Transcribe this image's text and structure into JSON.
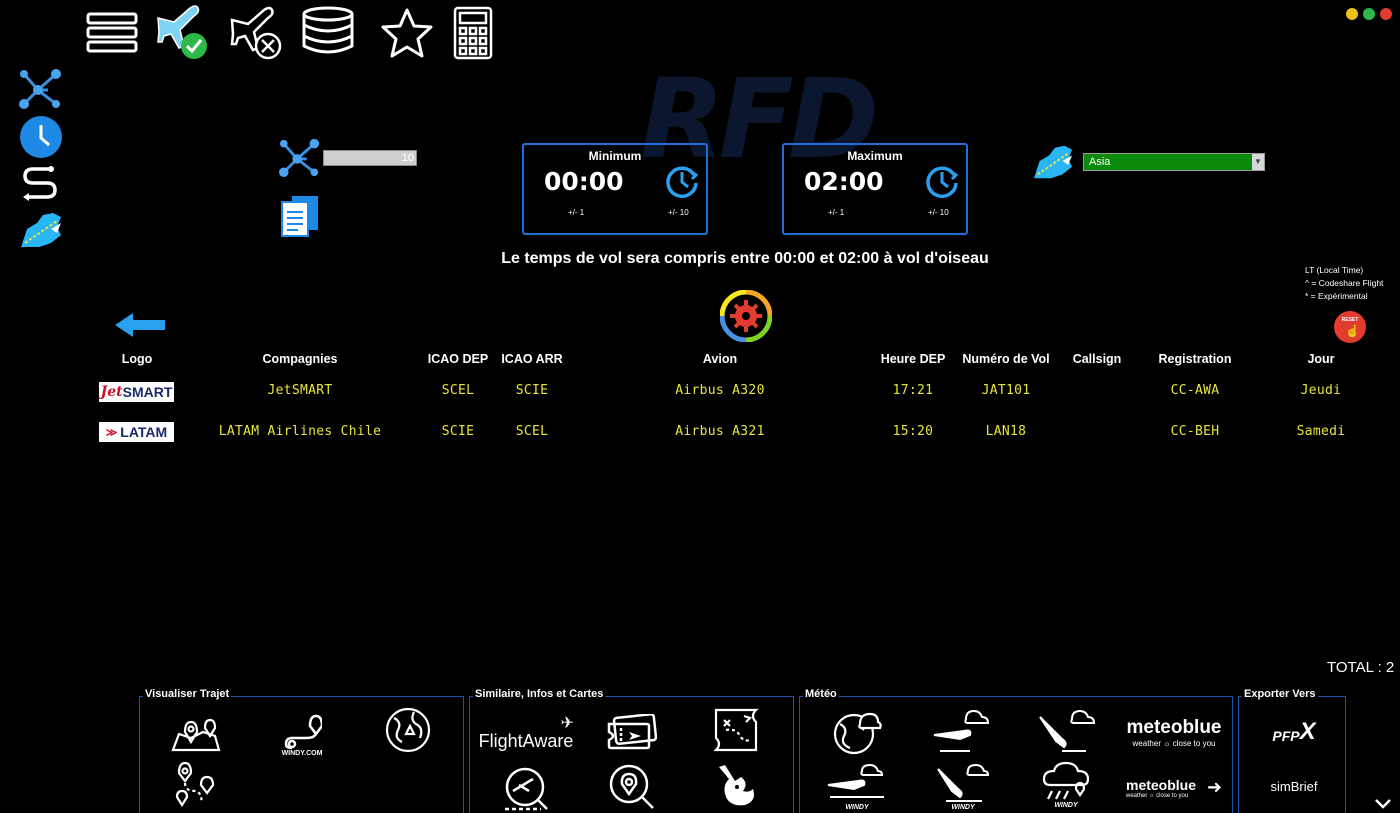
{
  "watermark": "RFD",
  "toolbar": {
    "icons": [
      "menu-icon",
      "plane-check-icon",
      "plane-cancel-icon",
      "database-icon",
      "star-icon",
      "calculator-icon"
    ]
  },
  "sidebar": {
    "icons": [
      "route-network-icon",
      "clock-icon",
      "path-icon",
      "airline-region-icon"
    ]
  },
  "range": {
    "value": "10"
  },
  "minimum": {
    "label": "Minimum",
    "time": "00:00",
    "step1": "+/- 1",
    "step10": "+/- 10"
  },
  "maximum": {
    "label": "Maximum",
    "time": "02:00",
    "step1": "+/- 1",
    "step10": "+/- 10"
  },
  "region": {
    "selected": "Asia"
  },
  "summary": "Le temps de vol sera compris entre 00:00 et 02:00 à vol d'oiseau",
  "legend": {
    "line1": "LT (Local Time)",
    "line2": "^ = Codeshare Flight",
    "line3": "* = Expérimental"
  },
  "reset_label": "RESET",
  "table": {
    "headers": {
      "logo": "Logo",
      "company": "Compagnies",
      "icao_dep": "ICAO DEP",
      "icao_arr": "ICAO ARR",
      "aircraft": "Avion",
      "dep_time": "Heure DEP",
      "flight_no": "Numéro de Vol",
      "callsign": "Callsign",
      "registration": "Registration",
      "day": "Jour"
    },
    "rows": [
      {
        "logo_a": "Jet",
        "logo_b": "SMART",
        "company": "JetSMART",
        "icao_dep": "SCEL",
        "icao_arr": "SCIE",
        "aircraft": "Airbus A320",
        "dep_time": "17:21",
        "flight_no": "JAT101",
        "callsign": "",
        "registration": "CC-AWA",
        "day": "Jeudi"
      },
      {
        "logo_a": "",
        "logo_b": "LATAM",
        "company": "LATAM Airlines Chile",
        "icao_dep": "SCIE",
        "icao_arr": "SCEL",
        "aircraft": "Airbus A321",
        "dep_time": "15:20",
        "flight_no": "LAN18",
        "callsign": "",
        "registration": "CC-BEH",
        "day": "Samedi"
      }
    ]
  },
  "total": "TOTAL : 2",
  "groups": {
    "trajet": {
      "title": "Visualiser Trajet",
      "windy": "WINDY.COM"
    },
    "similaire": {
      "title": "Similaire, Infos et Cartes",
      "flightaware": "FlightAware"
    },
    "meteo": {
      "title": "Météo",
      "meteoblue": "meteoblue",
      "meteoblue_tag": "weather ☼ close to you",
      "meteoblue2": "meteoblue",
      "meteoblue2_tag": "weather ☼ close to you",
      "windy": "WINDY"
    },
    "export": {
      "title": "Exporter Vers",
      "pfpx_a": "PFP",
      "pfpx_b": "X",
      "simbrief": "simBrief"
    }
  },
  "colors": {
    "accent_blue": "#1f6fd8",
    "table_text": "#e8e63a",
    "select_green": "#0b8a0b",
    "icon_cyan": "#29b6f6"
  }
}
